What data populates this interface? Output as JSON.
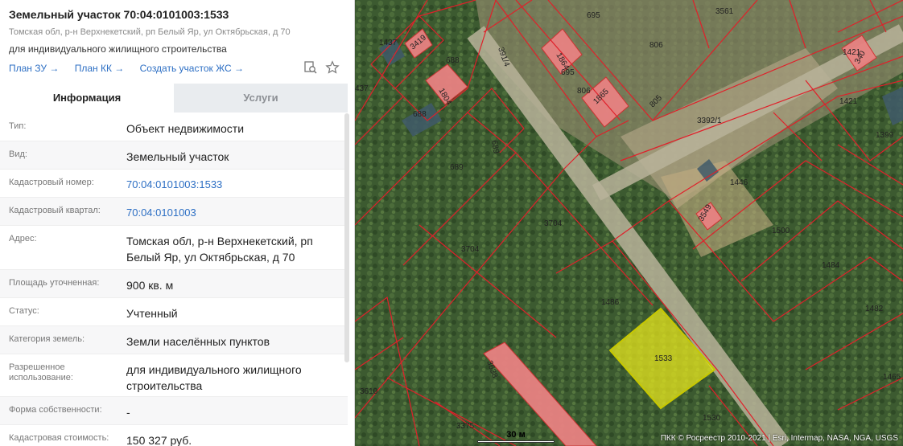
{
  "header": {
    "title": "Земельный участок 70:04:0101003:1533",
    "address": "Томская обл, р-н Верхнекетский, рп Белый Яр, ул Октябрьская, д 70",
    "purpose": "для индивидуального жилищного строительства",
    "links": [
      "План ЗУ →",
      "План КК →",
      "Создать участок ЖС →"
    ],
    "icons": [
      "search-doc-icon",
      "star-icon"
    ]
  },
  "tabs": {
    "info": "Информация",
    "services": "Услуги"
  },
  "rows": [
    {
      "label": "Тип:",
      "value": "Объект недвижимости"
    },
    {
      "label": "Вид:",
      "value": "Земельный участок"
    },
    {
      "label": "Кадастровый номер:",
      "value": "70:04:0101003:1533"
    },
    {
      "label": "Кадастровый квартал:",
      "value": "70:04:0101003"
    },
    {
      "label": "Адрес:",
      "value": "Томская обл, р-н Верхнекетский, рп Белый Яр, ул Октябрьская, д 70"
    },
    {
      "label": "Площадь уточненная:",
      "value": "900 кв. м"
    },
    {
      "label": "Статус:",
      "value": "Учтенный"
    },
    {
      "label": "Категория земель:",
      "value": "Земли населённых пунктов"
    },
    {
      "label": "Разрешенное использование:",
      "value": "для индивидуального жилищного строительства"
    },
    {
      "label": "Форма собственности:",
      "value": "-"
    },
    {
      "label": "Кадастровая стоимость:",
      "value": "150 327 руб."
    }
  ],
  "map": {
    "lot_labels": [
      "1437",
      "3419",
      "688",
      "1804",
      "391/4",
      "1864",
      "695",
      "806",
      "1865",
      "805",
      "3561",
      "1421",
      "1421",
      "3392/1",
      "1399",
      "437",
      "688",
      "689",
      "689",
      "1446",
      "3549",
      "3704",
      "3704",
      "1500",
      "1484",
      "1486",
      "1482",
      "1533",
      "1465",
      "3638",
      "3610",
      "3375",
      "1530",
      "391/4",
      "806",
      "695",
      "340"
    ],
    "scale": "30 м",
    "attribution": "ПКК © Росреестр 2010-2021 | Esri, Intermap, NASA, NGA, USGS",
    "colors": {
      "boundary": "#e0202a",
      "selected": "#e6e61e",
      "building": "#e88282"
    }
  }
}
